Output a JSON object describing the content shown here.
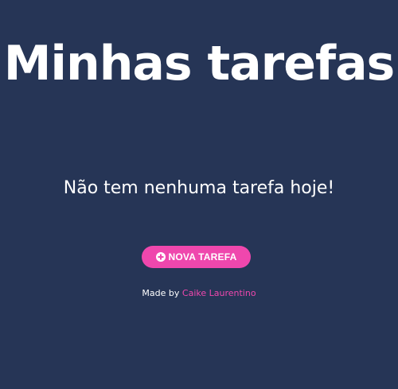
{
  "header": {
    "title": "Minhas tarefas"
  },
  "main": {
    "empty_message": "Não tem nenhuma tarefa hoje!",
    "new_task_button": {
      "label": "NOVA TAREFA",
      "icon": "plus-circle-icon"
    }
  },
  "footer": {
    "made_by_label": "Made by",
    "author_name": "Caike Laurentino"
  },
  "colors": {
    "background": "#263556",
    "accent": "#ef47ad",
    "text": "#ffffff"
  }
}
